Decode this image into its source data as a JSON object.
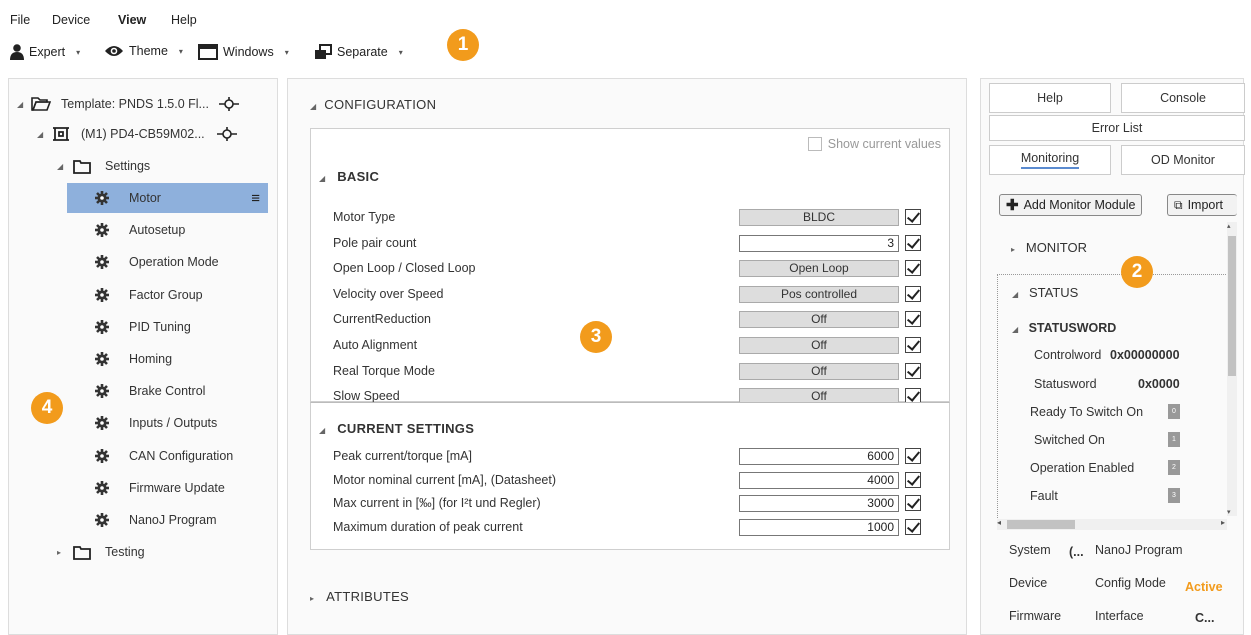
{
  "menu": [
    "File",
    "Device",
    "View",
    "Help"
  ],
  "toolbar": {
    "expert": "Expert",
    "theme": "Theme",
    "windows": "Windows",
    "separate": "Separate"
  },
  "callouts": [
    "1",
    "2",
    "3",
    "4"
  ],
  "tree": {
    "template": "Template: PNDS 1.5.0 Fl...",
    "device": "(M1) PD4-CB59M02...",
    "settings": "Settings",
    "items": [
      "Motor",
      "Autosetup",
      "Operation Mode",
      "Factor Group",
      "PID Tuning",
      "Homing",
      "Brake Control",
      "Inputs / Outputs",
      "CAN Configuration",
      "Firmware Update",
      "NanoJ Program"
    ],
    "testing": "Testing"
  },
  "config": {
    "title": "CONFIGURATION",
    "show_current": "Show current values",
    "basic_title": "BASIC",
    "basic": [
      {
        "label": "Motor Type",
        "value": "BLDC",
        "kind": "grey"
      },
      {
        "label": "Pole pair count",
        "value": "3",
        "kind": "white"
      },
      {
        "label": "Open Loop / Closed Loop",
        "value": "Open Loop",
        "kind": "grey"
      },
      {
        "label": "Velocity over Speed",
        "value": "Pos controlled",
        "kind": "grey"
      },
      {
        "label": "CurrentReduction",
        "value": "Off",
        "kind": "grey"
      },
      {
        "label": "Auto Alignment",
        "value": "Off",
        "kind": "grey"
      },
      {
        "label": "Real Torque Mode",
        "value": "Off",
        "kind": "grey"
      },
      {
        "label": "Slow Speed",
        "value": "Off",
        "kind": "grey"
      }
    ],
    "current_title": "CURRENT SETTINGS",
    "current": [
      {
        "label": "Peak current/torque [mA]",
        "value": "6000"
      },
      {
        "label": "Motor nominal current [mA], (Datasheet)",
        "value": "4000"
      },
      {
        "label": "Max current in  [‰] (for I²t und Regler)",
        "value": "3000"
      },
      {
        "label": "Maximum duration of peak current",
        "value": "1000"
      }
    ],
    "attributes": "ATTRIBUTES"
  },
  "right": {
    "tabs": {
      "help": "Help",
      "console": "Console",
      "error": "Error List",
      "monitoring": "Monitoring",
      "od": "OD Monitor"
    },
    "add_module": "Add Monitor Module",
    "import": "Import",
    "monitor": "MONITOR",
    "status": "STATUS",
    "statusword_title": "STATUSWORD",
    "controlword_label": "Controlword",
    "controlword_value": "0x00000000",
    "statusword_label": "Statusword",
    "statusword_value": "0x0000",
    "bits": [
      {
        "label": "Ready To Switch On",
        "bit": "0"
      },
      {
        "label": "Switched On",
        "bit": "1"
      },
      {
        "label": "Operation Enabled",
        "bit": "2"
      },
      {
        "label": "Fault",
        "bit": "3"
      }
    ],
    "footer": {
      "system": "System",
      "system_val": "(...",
      "nanoj": "NanoJ Program",
      "device": "Device",
      "config_mode": "Config Mode",
      "active": "Active",
      "firmware": "Firmware",
      "interface": "Interface",
      "interface_val": "C..."
    },
    "active_color": "#f29b1c"
  }
}
